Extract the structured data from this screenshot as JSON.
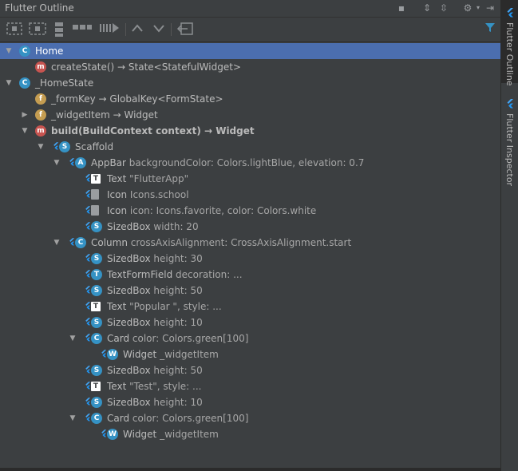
{
  "panel": {
    "title": "Flutter Outline"
  },
  "sidebar": {
    "tabs": [
      {
        "label": "Flutter Outline"
      },
      {
        "label": "Flutter Inspector"
      }
    ]
  },
  "colors": {
    "selection": "#4b6eaf",
    "class_icon": "#3592c4",
    "method_icon": "#c75450",
    "field_icon": "#c59d51",
    "flutter_blue": "#2196f3"
  },
  "tree": [
    {
      "main": "Home",
      "detail": ""
    },
    {
      "main": "createState() → State<StatefulWidget>",
      "detail": ""
    },
    {
      "main": "_HomeState",
      "detail": ""
    },
    {
      "main": "_formKey → GlobalKey<FormState>",
      "detail": ""
    },
    {
      "main": "_widgetItem → Widget",
      "detail": ""
    },
    {
      "main": "build(BuildContext context) → Widget",
      "detail": ""
    },
    {
      "main": "Scaffold",
      "detail": ""
    },
    {
      "main": "AppBar",
      "detail": " backgroundColor: Colors.lightBlue, elevation: 0.7"
    },
    {
      "main": "Text",
      "detail": " \"FlutterApp\""
    },
    {
      "main": "Icon",
      "detail": " Icons.school"
    },
    {
      "main": "Icon",
      "detail": " icon: Icons.favorite, color: Colors.white"
    },
    {
      "main": "SizedBox",
      "detail": " width: 20"
    },
    {
      "main": "Column",
      "detail": " crossAxisAlignment: CrossAxisAlignment.start"
    },
    {
      "main": "SizedBox",
      "detail": " height: 30"
    },
    {
      "main": "TextFormField",
      "detail": " decoration: ..."
    },
    {
      "main": "SizedBox",
      "detail": " height: 50"
    },
    {
      "main": "Text",
      "detail": " \"Popular \", style: ..."
    },
    {
      "main": "SizedBox",
      "detail": " height: 10"
    },
    {
      "main": "Card",
      "detail": " color: Colors.green[100]"
    },
    {
      "main": "Widget",
      "detail": " _widgetItem"
    },
    {
      "main": "SizedBox",
      "detail": " height: 50"
    },
    {
      "main": "Text",
      "detail": " \"Test\", style: ..."
    },
    {
      "main": "SizedBox",
      "detail": " height: 10"
    },
    {
      "main": "Card",
      "detail": " color: Colors.green[100]"
    },
    {
      "main": "Widget",
      "detail": " _widgetItem"
    }
  ]
}
